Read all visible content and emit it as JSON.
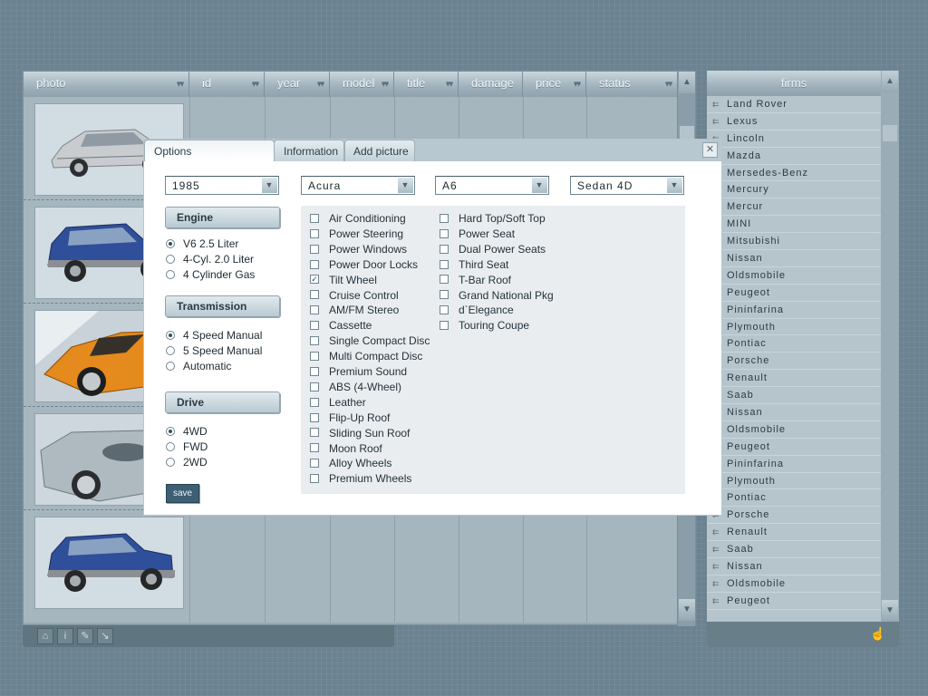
{
  "grid": {
    "columns": [
      {
        "label": "photo"
      },
      {
        "label": "id"
      },
      {
        "label": "year"
      },
      {
        "label": "model"
      },
      {
        "label": "title"
      },
      {
        "label": "damage"
      },
      {
        "label": "price"
      },
      {
        "label": "status"
      }
    ],
    "rows": [
      {
        "photo": "silver-minivan"
      },
      {
        "photo": "blue-suv"
      },
      {
        "photo": "orange-sports-car"
      },
      {
        "photo": "silver-roadster"
      },
      {
        "photo": "blue-suv"
      }
    ]
  },
  "toolbar": {
    "icons": [
      "home-icon",
      "info-icon",
      "pencil-icon",
      "export-icon"
    ]
  },
  "firms": {
    "title": "firms",
    "items": [
      "Land Rover",
      "Lexus",
      "Lincoln",
      "Mazda",
      "Mersedes-Benz",
      "Mercury",
      "Mercur",
      "MINI",
      "Mitsubishi",
      "Nissan",
      "Oldsmobile",
      "Peugeot",
      "Pininfarina",
      "Plymouth",
      "Pontiac",
      "Porsche",
      "Renault",
      "Saab",
      "Nissan",
      "Oldsmobile",
      "Peugeot",
      "Pininfarina",
      "Plymouth",
      "Pontiac",
      "Porsche",
      "Renault",
      "Saab",
      "Nissan",
      "Oldsmobile",
      "Peugeot"
    ]
  },
  "dialog": {
    "tabs": [
      {
        "label": "Options",
        "active": true
      },
      {
        "label": "Information",
        "active": false
      },
      {
        "label": "Add picture",
        "active": false
      }
    ],
    "selects": [
      "1985",
      "Acura",
      "A6",
      "Sedan 4D"
    ],
    "engine": {
      "title": "Engine",
      "options": [
        {
          "label": "V6 2.5 Liter",
          "checked": true
        },
        {
          "label": "4-Cyl. 2.0 Liter",
          "checked": false
        },
        {
          "label": "4 Cylinder Gas",
          "checked": false
        }
      ]
    },
    "transmission": {
      "title": "Transmission",
      "options": [
        {
          "label": "4 Speed Manual",
          "checked": true
        },
        {
          "label": "5 Speed Manual",
          "checked": false
        },
        {
          "label": "Automatic",
          "checked": false
        }
      ]
    },
    "drive": {
      "title": "Drive",
      "options": [
        {
          "label": "4WD",
          "checked": true
        },
        {
          "label": "FWD",
          "checked": false
        },
        {
          "label": "2WD",
          "checked": false
        }
      ]
    },
    "save_label": "save",
    "features_left": [
      {
        "label": "Air Conditioning",
        "checked": false
      },
      {
        "label": "Power Steering",
        "checked": false
      },
      {
        "label": "Power Windows",
        "checked": false
      },
      {
        "label": "Power Door Locks",
        "checked": false
      },
      {
        "label": "Tilt Wheel",
        "checked": true
      },
      {
        "label": "Cruise Control",
        "checked": false
      },
      {
        "label": "AM/FM Stereo",
        "checked": false
      },
      {
        "label": "Cassette",
        "checked": false
      },
      {
        "label": "Single Compact Disc",
        "checked": false
      },
      {
        "label": "Multi Compact Disc",
        "checked": false
      },
      {
        "label": "Premium Sound",
        "checked": false
      },
      {
        "label": "ABS (4-Wheel)",
        "checked": false
      },
      {
        "label": "Leather",
        "checked": false
      },
      {
        "label": "Flip-Up Roof",
        "checked": false
      },
      {
        "label": "Sliding Sun Roof",
        "checked": false
      },
      {
        "label": "Moon Roof",
        "checked": false
      },
      {
        "label": "Alloy Wheels",
        "checked": false
      },
      {
        "label": "Premium Wheels",
        "checked": false
      }
    ],
    "features_right": [
      {
        "label": "Hard Top/Soft Top",
        "checked": false
      },
      {
        "label": "Power Seat",
        "checked": false
      },
      {
        "label": "Dual Power Seats",
        "checked": false
      },
      {
        "label": "Third Seat",
        "checked": false
      },
      {
        "label": "T-Bar Roof",
        "checked": false
      },
      {
        "label": "Grand National Pkg",
        "checked": false
      },
      {
        "label": "d`Elegance",
        "checked": false
      },
      {
        "label": "Touring Coupe",
        "checked": false
      }
    ]
  }
}
